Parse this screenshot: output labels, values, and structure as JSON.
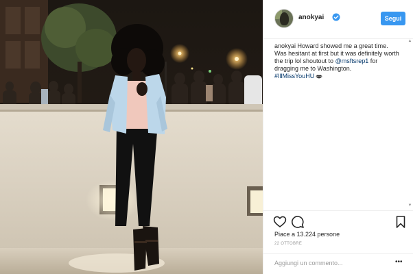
{
  "post": {
    "username": "anokyai",
    "follow_label": "Segui",
    "caption": {
      "user": "anokyai",
      "text_before": "Howard showed me a great time. Was hesitant at first but it was definitely worth the trip lol shoutout to",
      "mention": "@msftsrep1",
      "text_after": "for dragging me to Washington.",
      "hashtag": "#IllMissYouHU",
      "emoji_icon": "lips-icon"
    },
    "likes_label": "Piace a 13.224 persone",
    "date": "22 OTTOBRE",
    "comment_placeholder": "Aggiungi un commento..."
  },
  "icons": {
    "verified": "verified-badge-icon",
    "like": "heart-icon",
    "comment": "comment-bubble-icon",
    "save": "bookmark-icon",
    "more": "more-options-icon"
  },
  "colors": {
    "accent": "#3897f0",
    "link": "#003569",
    "text": "#262626",
    "muted": "#999999"
  }
}
